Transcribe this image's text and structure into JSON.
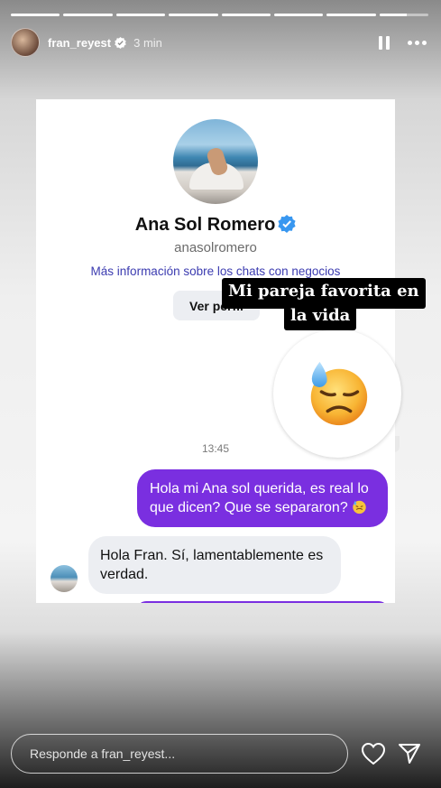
{
  "story": {
    "progress": [
      1,
      1,
      1,
      1,
      1,
      1,
      1,
      0.55
    ],
    "username": "fran_reyest",
    "time_ago": "3 min"
  },
  "shared_screenshot": {
    "profile": {
      "name": "Ana Sol Romero",
      "handle": "anasolromero",
      "business_link": "Más información sobre los chats con negocios",
      "view_profile_button": "Ver perfil"
    },
    "timestamp": "13:45",
    "messages": [
      {
        "from": "me",
        "text": "Hola mi Ana sol querida, es real lo que dicen? Que se separaron?"
      },
      {
        "from": "them",
        "text": "Hola Fran. Sí, lamentablemente es verdad."
      }
    ]
  },
  "sticker": {
    "line1": "Mi pareja favorita en",
    "line2": "la vida",
    "emoji": "downcast-face-with-sweat"
  },
  "reply_bar": {
    "placeholder": "Responde a fran_reyest..."
  },
  "colors": {
    "accent_purple": "#7a2fe0",
    "verified_blue": "#3897f0"
  }
}
